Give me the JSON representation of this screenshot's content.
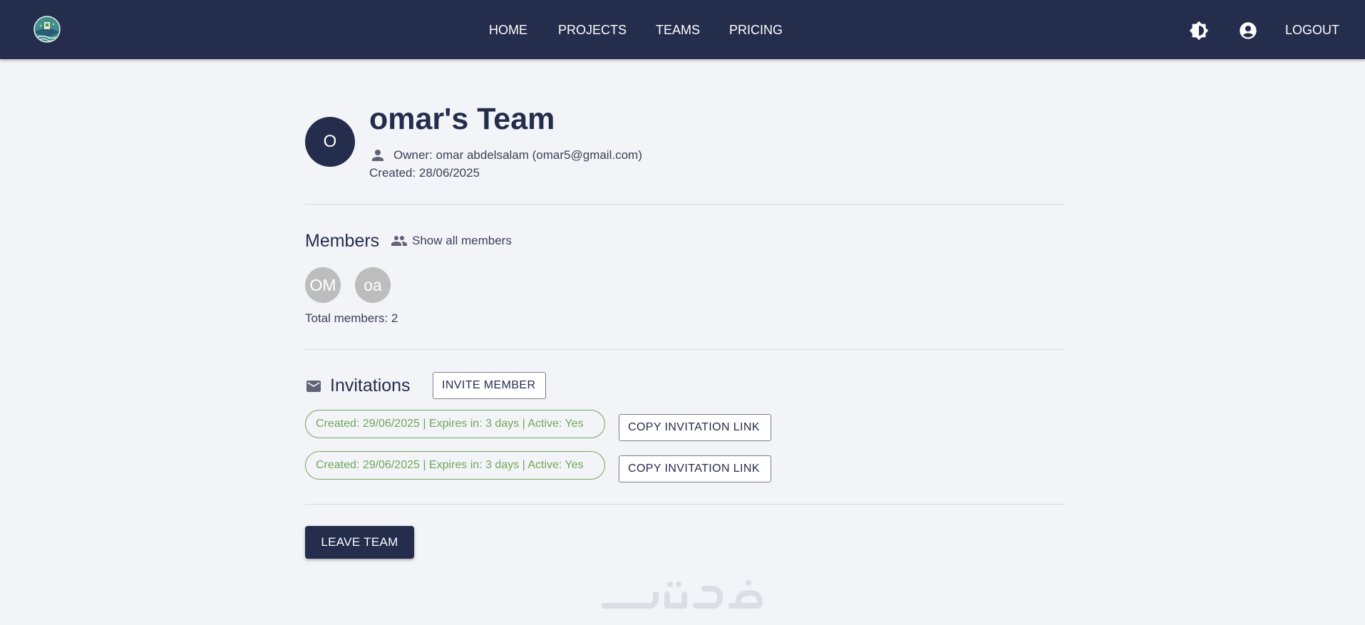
{
  "header": {
    "logo": "logo-icon",
    "nav": [
      {
        "label": "HOME"
      },
      {
        "label": "PROJECTS"
      },
      {
        "label": "TEAMS"
      },
      {
        "label": "PRICING"
      }
    ],
    "theme_icon": "brightness-icon",
    "account_icon": "account-circle-icon",
    "logout_label": "LOGOUT"
  },
  "team": {
    "avatar_letter": "O",
    "title": "omar's Team",
    "owner": "Owner: omar abdelsalam (omar5@gmail.com)",
    "created": "Created: 28/06/2025"
  },
  "members": {
    "heading": "Members",
    "show_all_label": "Show all members",
    "avatars": [
      "OM",
      "oa"
    ],
    "total": "Total members: 2"
  },
  "invitations": {
    "heading": "Invitations",
    "invite_label": "INVITE MEMBER",
    "items": [
      {
        "status": "Created: 29/06/2025 | Expires in: 3 days | Active: Yes",
        "copy_label": "COPY INVITATION LINK"
      },
      {
        "status": "Created: 29/06/2025 | Expires in: 3 days | Active: Yes",
        "copy_label": "COPY INVITATION LINK"
      }
    ]
  },
  "leave_label": "LEAVE TEAM",
  "colors": {
    "navbar": "#252d4c",
    "background": "#f3f4f8",
    "active_chip": "#6fa65a",
    "member_avatar": "#bdbdbd"
  }
}
